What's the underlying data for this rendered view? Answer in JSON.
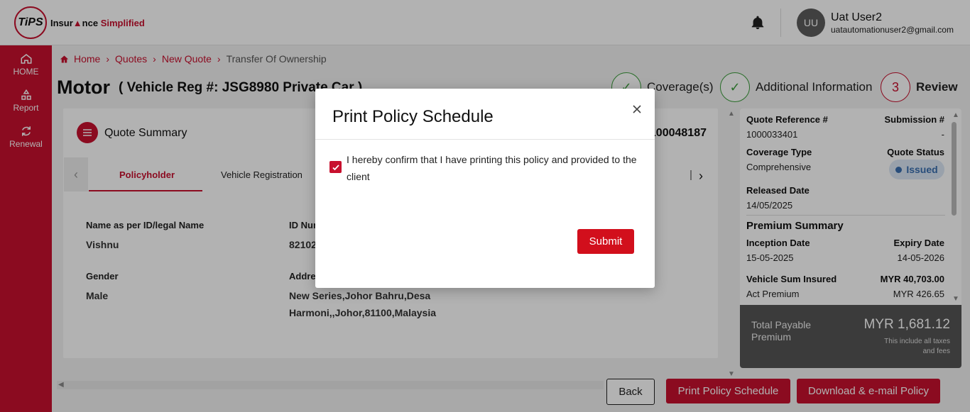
{
  "header": {
    "logo_mark": "TiPS",
    "logo_text_a": "Insur",
    "logo_text_b": "nce",
    "logo_text_red": " Simplified",
    "avatar_initials": "UU",
    "user_name": "Uat User2",
    "user_email": "uatautomationuser2@gmail.com"
  },
  "sidebar": {
    "items": [
      {
        "label": "HOME",
        "icon": "home-icon"
      },
      {
        "label": "Report",
        "icon": "report-icon"
      },
      {
        "label": "Renewal",
        "icon": "renewal-icon"
      }
    ]
  },
  "breadcrumb": {
    "home": "Home",
    "quotes": "Quotes",
    "new_quote": "New Quote",
    "current": "Transfer Of Ownership"
  },
  "page": {
    "title": "Motor",
    "subtitle": "( Vehicle Reg #: JSG8980 Private Car )"
  },
  "stepper": {
    "steps": [
      {
        "label": "Coverage(s)",
        "state": "done"
      },
      {
        "label": "Additional Information",
        "state": "done"
      },
      {
        "label": "Review",
        "number": "3",
        "state": "active"
      }
    ]
  },
  "quote_summary": {
    "title": "Quote Summary",
    "number_fragment": "100048187",
    "tabs": [
      "Policyholder",
      "Vehicle Registration"
    ],
    "fields": {
      "name_label": "Name as per ID/legal Name",
      "name_value": "Vishnu",
      "id_label": "ID Num",
      "id_value": "82102",
      "gender_label": "Gender",
      "gender_value": "Male",
      "address_label": "Addres",
      "address_line1": "New Series,Johor Bahru,Desa",
      "address_line2": "Harmoni,,Johor,81100,Malaysia"
    }
  },
  "right_panel": {
    "quote_ref_label": "Quote Reference #",
    "quote_ref_value": "1000033401",
    "submission_label": "Submission #",
    "submission_value": "-",
    "coverage_type_label": "Coverage Type",
    "coverage_type_value": "Comprehensive",
    "quote_status_label": "Quote Status",
    "quote_status_value": "Issued",
    "released_date_label": "Released Date",
    "released_date_value": "14/05/2025",
    "premium_summary_title": "Premium Summary",
    "inception_label": "Inception Date",
    "inception_value": "15-05-2025",
    "expiry_label": "Expiry Date",
    "expiry_value": "14-05-2026",
    "sum_insured_label": "Vehicle Sum Insured",
    "sum_insured_value": "MYR 40,703.00",
    "act_premium_label": "Act Premium",
    "act_premium_value": "MYR 426.65",
    "total_label": "Total Payable Premium",
    "total_value": "MYR 1,681.12",
    "total_note": "This include all taxes and fees"
  },
  "footer_buttons": {
    "back": "Back",
    "print": "Print Policy Schedule",
    "download": "Download & e-mail Policy"
  },
  "modal": {
    "title": "Print Policy Schedule",
    "confirm_text": "I hereby confirm that I have printing this policy and provided to the client",
    "checkbox_checked": true,
    "submit_label": "Submit"
  },
  "colors": {
    "brand_red": "#c8102e",
    "success_green": "#3a9d3a",
    "status_blue": "#3a6fb0"
  }
}
